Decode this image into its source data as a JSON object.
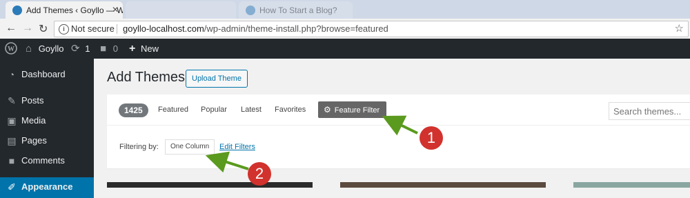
{
  "browser": {
    "tabs": [
      {
        "title": "Add Themes ‹ Goyllo — W",
        "active": true
      },
      {
        "title": "",
        "active": false
      },
      {
        "title": "How To Start a Blog?",
        "active": false
      }
    ],
    "address": {
      "security": "Not secure",
      "host": "goyllo-localhost.com",
      "path": "/wp-admin/theme-install.php?browse=featured"
    },
    "icons": {
      "back": "back-arrow-icon",
      "forward": "forward-arrow-icon",
      "reload": "reload-icon",
      "star": "bookmark-star-icon"
    }
  },
  "adminbar": {
    "site_name": "Goyllo",
    "updates_count": "1",
    "comments_count": "0",
    "new_label": "New"
  },
  "sidebar": {
    "items": [
      {
        "label": "Dashboard",
        "icon": "dashboard-icon"
      },
      {
        "label": "Posts",
        "icon": "pin-icon"
      },
      {
        "label": "Media",
        "icon": "media-icon"
      },
      {
        "label": "Pages",
        "icon": "pages-icon"
      },
      {
        "label": "Comments",
        "icon": "comment-icon"
      },
      {
        "label": "Appearance",
        "icon": "appearance-icon"
      }
    ]
  },
  "main": {
    "title": "Add Themes",
    "upload_label": "Upload Theme",
    "theme_count": "1425",
    "filter_tabs": [
      "Featured",
      "Popular",
      "Latest",
      "Favorites"
    ],
    "feature_filter_label": "Feature Filter",
    "search_placeholder": "Search themes...",
    "filtering_by_label": "Filtering by:",
    "active_filter": "One Column",
    "edit_filters_label": "Edit Filters"
  },
  "annotations": [
    {
      "number": "1"
    },
    {
      "number": "2"
    }
  ],
  "colors": {
    "admin_bar": "#23282d",
    "accent_blue": "#0073aa",
    "annotation_red": "#d2322d",
    "annotation_arrow": "#5a9a1e"
  }
}
